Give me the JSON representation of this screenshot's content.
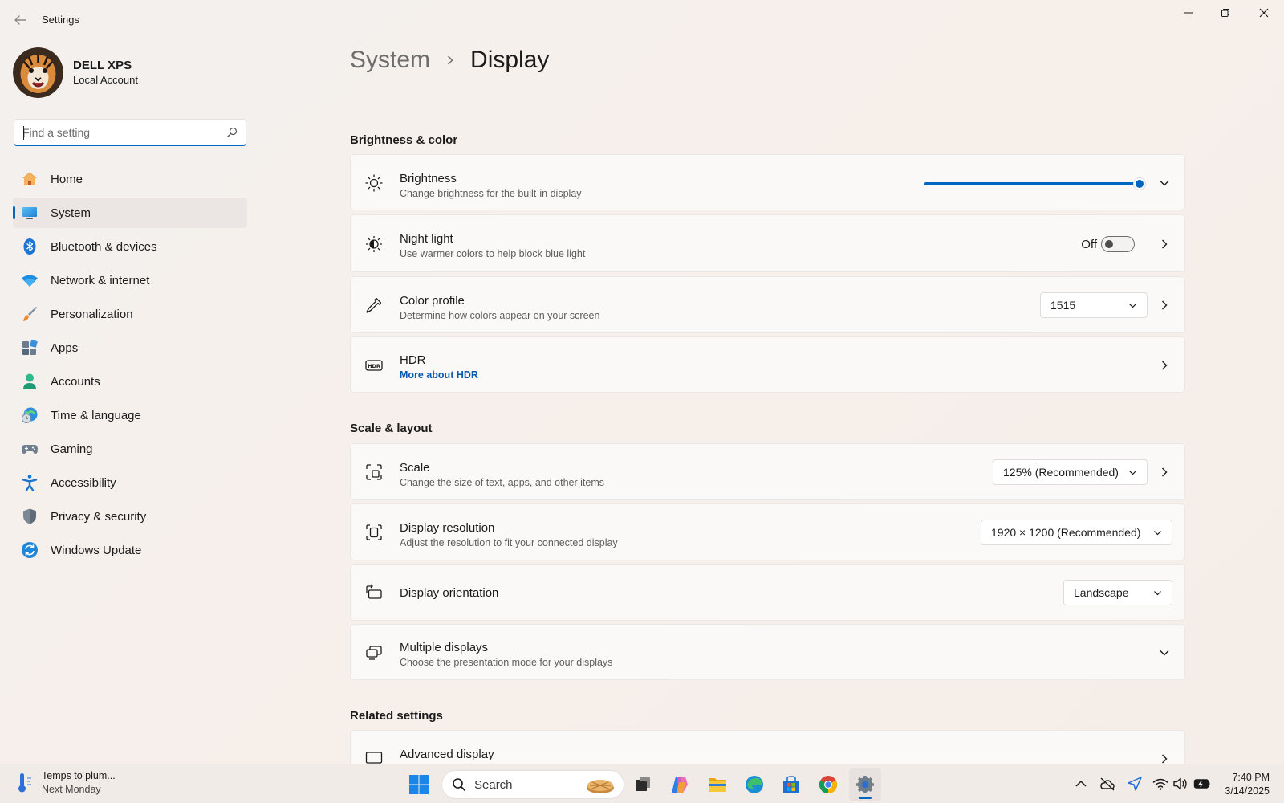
{
  "window": {
    "title": "Settings"
  },
  "profile": {
    "name": "DELL XPS",
    "account_type": "Local Account"
  },
  "search": {
    "placeholder": "Find a setting",
    "value": ""
  },
  "nav": {
    "items": [
      {
        "label": "Home",
        "icon": "home-icon",
        "active": false
      },
      {
        "label": "System",
        "icon": "system-icon",
        "active": true
      },
      {
        "label": "Bluetooth & devices",
        "icon": "bluetooth-icon",
        "active": false
      },
      {
        "label": "Network & internet",
        "icon": "wifi-icon",
        "active": false
      },
      {
        "label": "Personalization",
        "icon": "brush-icon",
        "active": false
      },
      {
        "label": "Apps",
        "icon": "apps-icon",
        "active": false
      },
      {
        "label": "Accounts",
        "icon": "person-icon",
        "active": false
      },
      {
        "label": "Time & language",
        "icon": "globe-clock-icon",
        "active": false
      },
      {
        "label": "Gaming",
        "icon": "gamepad-icon",
        "active": false
      },
      {
        "label": "Accessibility",
        "icon": "accessibility-icon",
        "active": false
      },
      {
        "label": "Privacy & security",
        "icon": "shield-icon",
        "active": false
      },
      {
        "label": "Windows Update",
        "icon": "update-icon",
        "active": false
      }
    ]
  },
  "breadcrumb": {
    "parent": "System",
    "current": "Display"
  },
  "sections": {
    "brightness_color": "Brightness & color",
    "scale_layout": "Scale & layout",
    "related": "Related settings"
  },
  "brightness": {
    "title": "Brightness",
    "subtitle": "Change brightness for the built-in display",
    "level_percent": 100
  },
  "night_light": {
    "title": "Night light",
    "subtitle": "Use warmer colors to help block blue light",
    "state_label": "Off",
    "on": false
  },
  "color_profile": {
    "title": "Color profile",
    "subtitle": "Determine how colors appear on your screen",
    "value": "1515"
  },
  "hdr": {
    "title": "HDR",
    "link": "More about HDR"
  },
  "scale": {
    "title": "Scale",
    "subtitle": "Change the size of text, apps, and other items",
    "value": "125% (Recommended)"
  },
  "resolution": {
    "title": "Display resolution",
    "subtitle": "Adjust the resolution to fit your connected display",
    "value": "1920 × 1200 (Recommended)"
  },
  "orientation": {
    "title": "Display orientation",
    "value": "Landscape"
  },
  "multiple_displays": {
    "title": "Multiple displays",
    "subtitle": "Choose the presentation mode for your displays"
  },
  "advanced_display": {
    "title": "Advanced display"
  },
  "taskbar": {
    "weather_title": "Temps to plum...",
    "weather_sub": "Next Monday",
    "search_label": "Search",
    "time": "7:40 PM",
    "date": "3/14/2025"
  },
  "colors": {
    "accent": "#0067c0",
    "link": "#0a5bb0"
  }
}
